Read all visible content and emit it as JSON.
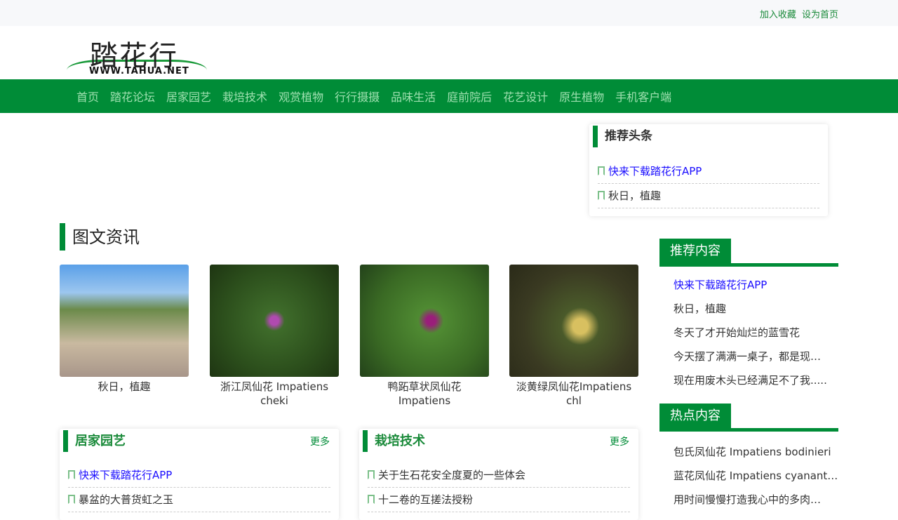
{
  "topbar": {
    "favorite": "加入收藏",
    "homepage": "设为首页"
  },
  "logo": {
    "cn": "踏花行",
    "url": "WWW.TAHUA.NET"
  },
  "nav": [
    "首页",
    "踏花论坛",
    "居家园艺",
    "栽培技术",
    "观赏植物",
    "行行摄摄",
    "品味生活",
    "庭前院后",
    "花艺设计",
    "原生植物",
    "手机客户端"
  ],
  "headlines": {
    "title": "推荐头条",
    "items": [
      "快来下载踏花行APP",
      "秋日，植趣"
    ]
  },
  "news": {
    "title": "图文资讯",
    "items": [
      {
        "caption": "秋日，植趣"
      },
      {
        "caption": "浙江凤仙花 Impatiens cheki"
      },
      {
        "caption": "鸭跖草状凤仙花 Impatiens"
      },
      {
        "caption": "淡黄绿凤仙花Impatiens chl"
      }
    ]
  },
  "home_garden": {
    "title": "居家园艺",
    "more": "更多",
    "items": [
      "快来下载踏花行APP",
      "暴盆的大普货虹之玉"
    ]
  },
  "cultivation": {
    "title": "栽培技术",
    "more": "更多",
    "items": [
      "关于生石花安全度夏的一些体会",
      "十二卷的互搓法授粉"
    ]
  },
  "recommended": {
    "title": "推荐内容",
    "items": [
      "快来下载踏花行APP",
      "秋日，植趣",
      "冬天了才开始灿烂的蓝雪花",
      "今天摆了满满一桌子，都是现在的多肉",
      "现在用废木头已经满足不了我....."
    ]
  },
  "hot": {
    "title": "热点内容",
    "items": [
      "包氏凤仙花 Impatiens bodinieri",
      "蓝花凤仙花 Impatiens cyanantha",
      "用时间慢慢打造我心中的多肉花园"
    ]
  },
  "colors": {
    "brand": "#008c37",
    "link": "#1a0dff"
  }
}
